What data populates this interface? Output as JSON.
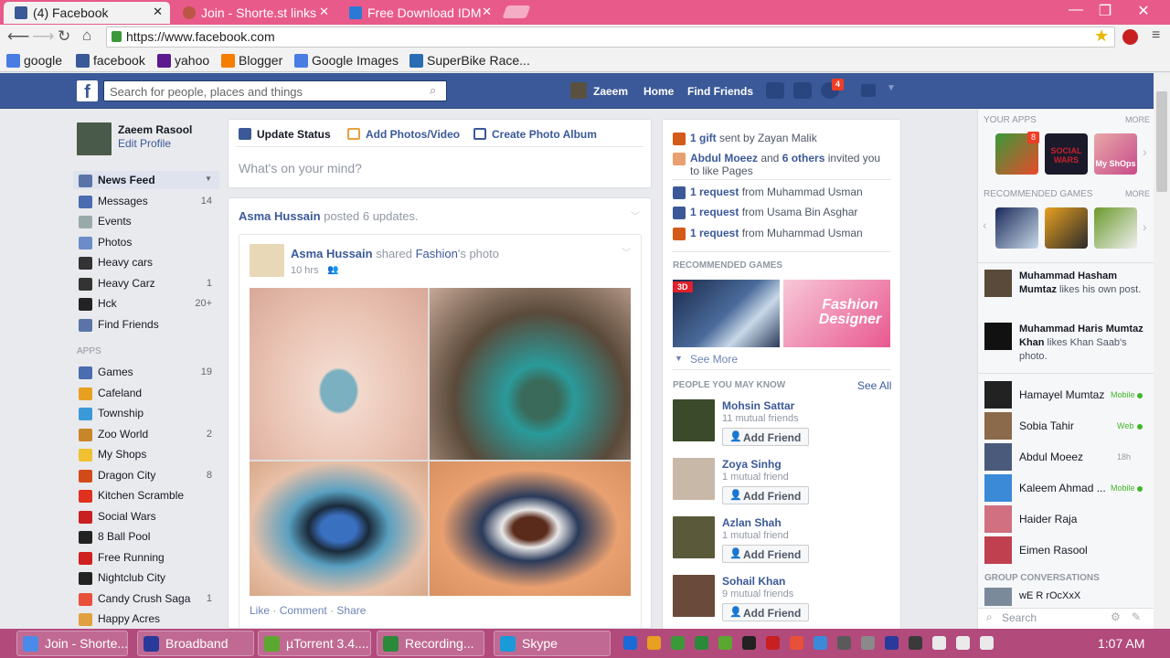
{
  "browser": {
    "tabs": [
      {
        "title": "(4) Facebook",
        "color": "#3b5998"
      },
      {
        "title": "Join - Shorte.st links",
        "color": "#b54"
      },
      {
        "title": "Free Download IDM",
        "color": "#2a7ad5"
      }
    ],
    "url": "https://www.facebook.com",
    "bookmarks": [
      {
        "label": "google",
        "color": "#4a7de2"
      },
      {
        "label": "facebook",
        "color": "#3b5998"
      },
      {
        "label": "yahoo",
        "color": "#5b1a8e"
      },
      {
        "label": "Blogger",
        "color": "#f57d00"
      },
      {
        "label": "Google Images",
        "color": "#4a7de2"
      },
      {
        "label": "SuperBike Race...",
        "color": "#2a6db3"
      }
    ]
  },
  "fb_header": {
    "search_placeholder": "Search for people, places and things",
    "user": "Zaeem",
    "home": "Home",
    "find_friends": "Find Friends",
    "notifications": "4"
  },
  "left_nav": {
    "profile_name": "Zaeem Rasool",
    "edit_profile": "Edit Profile",
    "items": [
      {
        "label": "News Feed",
        "count": "",
        "color": "#5b74a8"
      },
      {
        "label": "Messages",
        "count": "14",
        "color": "#4a6cb0"
      },
      {
        "label": "Events",
        "count": "",
        "color": "#9aa"
      },
      {
        "label": "Photos",
        "count": "",
        "color": "#6b8cc8"
      },
      {
        "label": "Heavy cars",
        "count": "",
        "color": "#333"
      },
      {
        "label": "Heavy Carz",
        "count": "1",
        "color": "#333"
      },
      {
        "label": "Hck",
        "count": "20+",
        "color": "#222"
      },
      {
        "label": "Find Friends",
        "count": "",
        "color": "#5b74a8"
      }
    ],
    "apps_heading": "APPS",
    "apps": [
      {
        "label": "Games",
        "count": "19",
        "color": "#4a6cb0"
      },
      {
        "label": "Cafeland",
        "count": "",
        "color": "#e8a020"
      },
      {
        "label": "Township",
        "count": "",
        "color": "#3a9ad8"
      },
      {
        "label": "Zoo World",
        "count": "2",
        "color": "#c8862a"
      },
      {
        "label": "My Shops",
        "count": "",
        "color": "#f0c030"
      },
      {
        "label": "Dragon City",
        "count": "8",
        "color": "#d24a1a"
      },
      {
        "label": "Kitchen Scramble",
        "count": "",
        "color": "#e03020"
      },
      {
        "label": "Social Wars",
        "count": "",
        "color": "#c82020"
      },
      {
        "label": "8 Ball Pool",
        "count": "",
        "color": "#222"
      },
      {
        "label": "Free Running",
        "count": "",
        "color": "#d02020"
      },
      {
        "label": "Nightclub City",
        "count": "",
        "color": "#222"
      },
      {
        "label": "Candy Crush Saga",
        "count": "1",
        "color": "#e8503a"
      },
      {
        "label": "Happy Acres",
        "count": "",
        "color": "#e0a040"
      }
    ]
  },
  "composer": {
    "update_status": "Update Status",
    "add_photos": "Add Photos/Video",
    "create_album": "Create Photo Album",
    "placeholder": "What's on your mind?"
  },
  "story": {
    "header_name": "Asma Hussain",
    "header_rest": "posted 6 updates.",
    "post_name": "Asma Hussain",
    "post_mid": "shared",
    "post_owner": "Fashion",
    "post_tail": "'s photo",
    "time": "10 hrs",
    "like": "Like",
    "comment": "Comment",
    "share": "Share",
    "dot": "·"
  },
  "notifications_box": [
    {
      "bold": "1 gift",
      "rest": " sent by Zayan Malik",
      "color": "#d45a1a"
    },
    {
      "bold": "Abdul Moeez",
      "rest": " and ",
      "bold2": "6 others",
      "rest2": " invited you to like Pages",
      "color": "#e8a070"
    },
    {
      "bold": "1 request",
      "rest": " from Muhammad Usman",
      "color": "#3b5998"
    },
    {
      "bold": "1 request",
      "rest": " from Usama Bin Asghar",
      "color": "#3b5998"
    },
    {
      "bold": "1 request",
      "rest": " from Muhammad Usman",
      "color": "#d45a1a"
    }
  ],
  "recommended_games": {
    "heading": "RECOMMENDED GAMES",
    "badge": "3D",
    "fashion_label": "Fashion Designer",
    "see_more": "See More"
  },
  "people": {
    "heading": "PEOPLE YOU MAY KNOW",
    "see_all": "See All",
    "add_label": "Add Friend",
    "items": [
      {
        "name": "Mohsin Sattar",
        "mutual": "11 mutual friends",
        "color": "#3a4a2a"
      },
      {
        "name": "Zoya Sinhg",
        "mutual": "1 mutual friend",
        "color": "#c8b8a8"
      },
      {
        "name": "Azlan Shah",
        "mutual": "1 mutual friend",
        "color": "#5a5a3a"
      },
      {
        "name": "Sohail Khan",
        "mutual": "9 mutual friends",
        "color": "#6a4a3a"
      }
    ]
  },
  "right_col": {
    "your_apps": "YOUR APPS",
    "more": "MORE",
    "app_badge": "8",
    "rec_games": "RECOMMENDED GAMES",
    "social_wars": "SOCIAL WARS",
    "my_shops": "My ShOps",
    "ticker": [
      {
        "name": "Muhammad Hasham Mumtaz",
        "rest": " likes his own post."
      },
      {
        "name": "Muhammad Haris Mumtaz Khan",
        "rest": " likes Khan Saab's photo."
      }
    ],
    "chat": [
      {
        "name": "Hamayel Mumtaz",
        "status": "Mobile",
        "dot": "#42b72a",
        "color": "#222"
      },
      {
        "name": "Sobia Tahir",
        "status": "Web",
        "dot": "#42b72a",
        "color": "#8a6a4a"
      },
      {
        "name": "Abdul Moeez",
        "status": "18h",
        "dot": "",
        "color": "#4a5a7a"
      },
      {
        "name": "Kaleem Ahmad ...",
        "status": "Mobile",
        "dot": "#42b72a",
        "color": "#3a8ad8"
      },
      {
        "name": "Haider Raja",
        "status": "",
        "dot": "",
        "color": "#d07080"
      },
      {
        "name": "Eimen Rasool",
        "status": "",
        "dot": "",
        "color": "#c04050"
      }
    ],
    "group_heading": "GROUP CONVERSATIONS",
    "group_name": "wE R rOcXxX",
    "search": "Search"
  },
  "taskbar": {
    "items": [
      {
        "label": "Join - Shorte....",
        "color": "#4a8ae8"
      },
      {
        "label": "Broadband",
        "color": "#2a3a9a"
      },
      {
        "label": "µTorrent 3.4....",
        "color": "#5aa830"
      },
      {
        "label": "Recording...",
        "color": "#2a8a3a"
      },
      {
        "label": "Skype",
        "color": "#1a9ad8"
      }
    ],
    "time": "1:07 AM"
  }
}
